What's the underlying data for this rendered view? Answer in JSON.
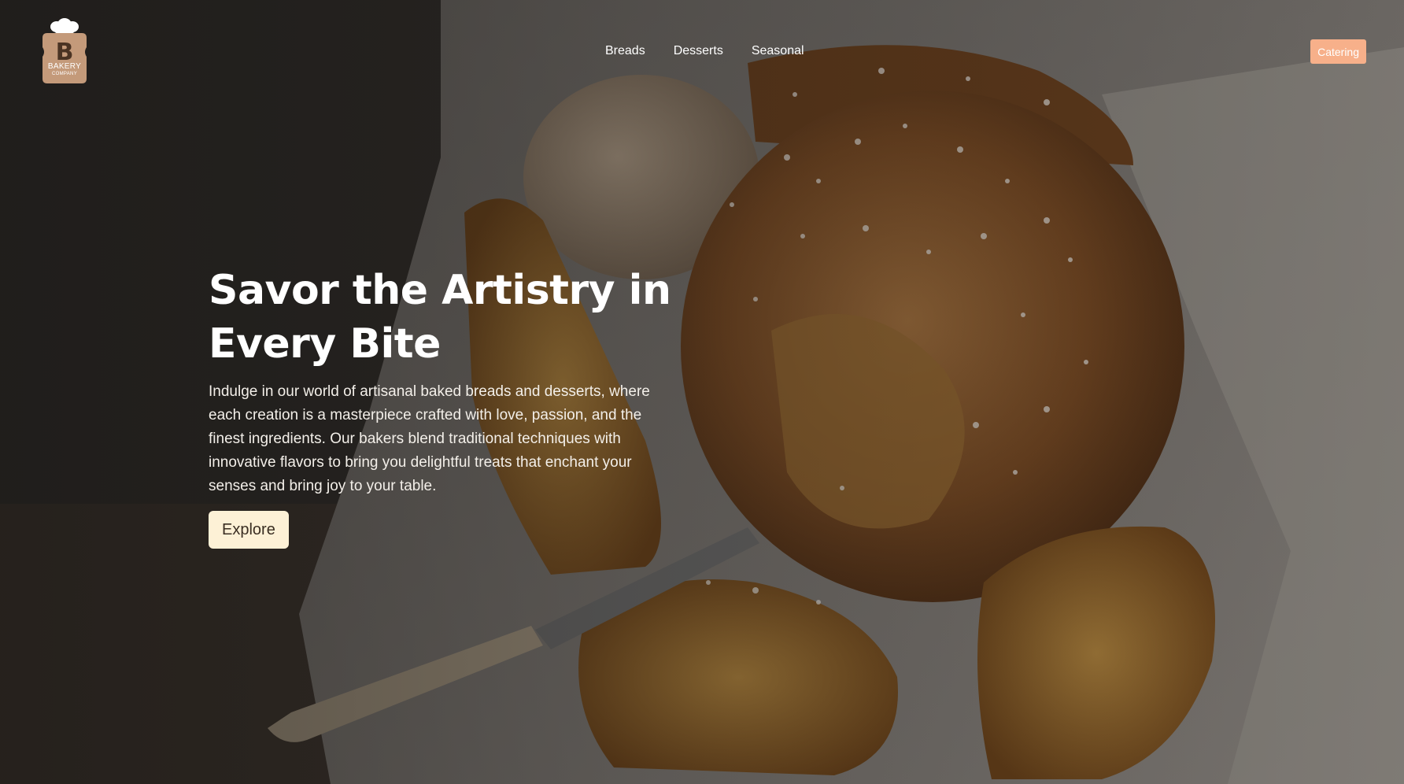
{
  "brand": {
    "logo_letter": "B",
    "logo_name": "BAKERY",
    "logo_sub": "COMPANY",
    "logo_color": "#c49a7a"
  },
  "nav": {
    "items": [
      {
        "label": "Breads"
      },
      {
        "label": "Desserts"
      },
      {
        "label": "Seasonal"
      }
    ]
  },
  "header": {
    "cta_label": "Catering",
    "cta_color": "#f7b08a"
  },
  "hero": {
    "title": "Savor the Artistry in Every Bite",
    "description": "Indulge in our world of artisanal baked breads and desserts, where each creation is a masterpiece crafted with love, passion, and the finest ingredients. Our bakers blend traditional techniques with innovative flavors to bring you delightful treats that enchant your senses and bring joy to your table.",
    "button_label": "Explore",
    "button_color": "#fdf1d6"
  }
}
